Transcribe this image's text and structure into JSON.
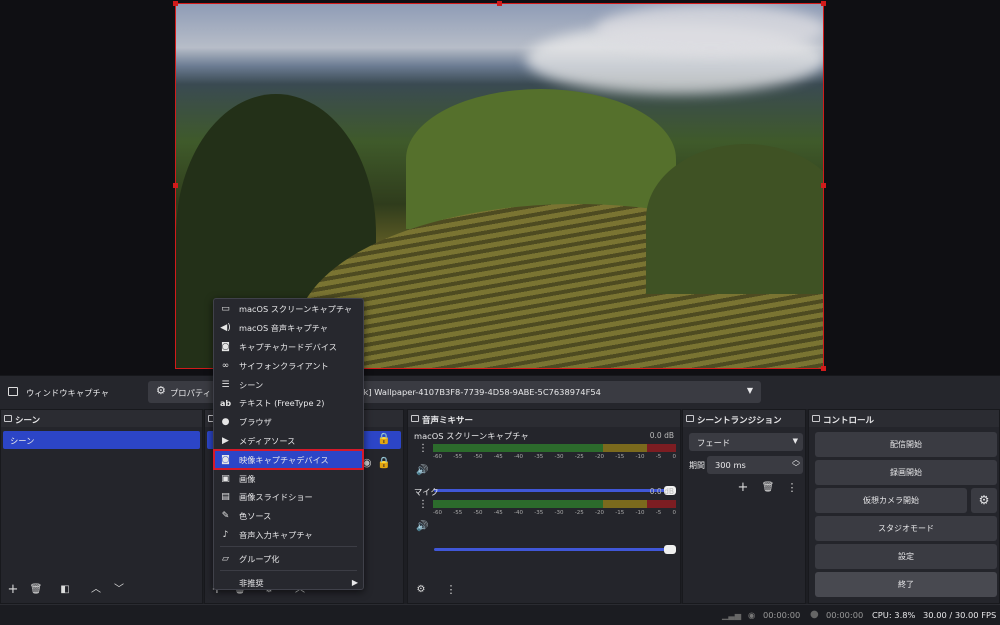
{
  "source_toolbar": {
    "source_name": "ウィンドウキャプチャ",
    "properties_label": "プロパティ",
    "window_value": "ck] Wallpaper-4107B3F8-7739-4D58-9ABE-5C7638974F54"
  },
  "scenes": {
    "title": "シーン",
    "items": [
      "シーン"
    ]
  },
  "context_menu": {
    "items": [
      "macOS スクリーンキャプチャ",
      "macOS 音声キャプチャ",
      "キャプチャカードデバイス",
      "サイフォンクライアント",
      "シーン",
      "テキスト (FreeType 2)",
      "ブラウザ",
      "メディアソース",
      "映像キャプチャデバイス",
      "画像",
      "画像スライドショー",
      "色ソース",
      "音声入力キャプチャ"
    ],
    "group_label": "グループ化",
    "deprecated_label": "非推奨",
    "selected": "映像キャプチャデバイス",
    "icons": [
      "monitor-icon",
      "speaker-icon",
      "camera-icon",
      "glasses-icon",
      "list-icon",
      "text-icon",
      "globe-icon",
      "play-icon",
      "camera-icon",
      "image-icon",
      "slideshow-icon",
      "brush-icon",
      "mic-icon"
    ]
  },
  "mixer": {
    "title": "音声ミキサー",
    "channels": [
      {
        "name": "macOS スクリーンキャプチャ",
        "db": "0.0 dB"
      },
      {
        "name": "マイク",
        "db": "0.0 dB"
      }
    ],
    "scale": [
      "-60",
      "-55",
      "-50",
      "-45",
      "-40",
      "-35",
      "-30",
      "-25",
      "-20",
      "-15",
      "-10",
      "-5",
      "0"
    ]
  },
  "transitions": {
    "title": "シーントランジション",
    "type": "フェード",
    "duration_label": "期間",
    "duration": "300 ms"
  },
  "controls": {
    "title": "コントロール",
    "buttons": [
      "配信開始",
      "録画開始",
      "仮想カメラ開始",
      "スタジオモード",
      "設定",
      "終了"
    ]
  },
  "status": {
    "stream_time": "00:00:00",
    "rec_time": "00:00:00",
    "cpu": "CPU: 3.8%",
    "fps": "30.00 / 30.00 FPS"
  },
  "colors": {
    "accent": "#2c45c7",
    "highlight_border": "#d5192a",
    "preview_border": "#d11b1b"
  }
}
